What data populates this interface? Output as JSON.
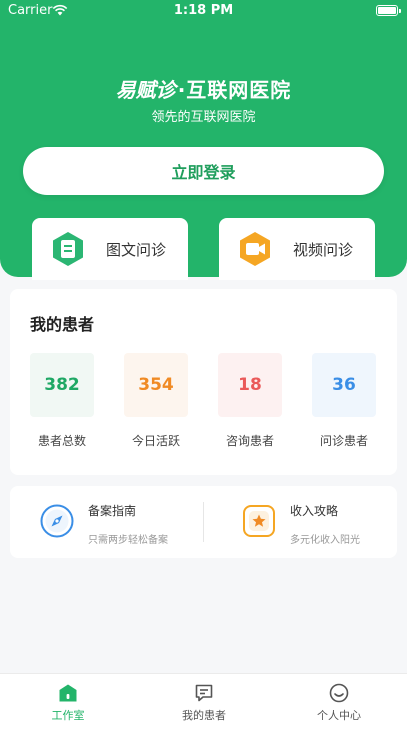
{
  "status_bar": {
    "carrier": "Carrier",
    "time": "1:18 PM"
  },
  "header": {
    "logo_mark": "易赋诊",
    "brand_suffix": "·互联网医院",
    "tagline": "领先的互联网医院",
    "login_label": "立即登录",
    "consult_options": [
      {
        "label": "图文问诊",
        "icon": "document-icon",
        "color": "#2bb673"
      },
      {
        "label": "视频问诊",
        "icon": "video-camera-icon",
        "color": "#f5a623"
      }
    ]
  },
  "my_patients": {
    "title": "我的患者",
    "stats": [
      {
        "value": "382",
        "label": "患者总数",
        "color": "#1fa865",
        "bg": "#f1f8f4"
      },
      {
        "value": "354",
        "label": "今日活跃",
        "color": "#f08a24",
        "bg": "#fdf5ee"
      },
      {
        "value": "18",
        "label": "咨询患者",
        "color": "#ea5a5a",
        "bg": "#fdf1f1"
      },
      {
        "value": "36",
        "label": "问诊患者",
        "color": "#3a8ee6",
        "bg": "#eff6fd"
      }
    ]
  },
  "guides": [
    {
      "title": "备案指南",
      "subtitle": "只需两步轻松备案",
      "icon": "compass-icon",
      "color": "#3a8ee6"
    },
    {
      "title": "收入攻略",
      "subtitle": "多元化收入阳光",
      "icon": "star-badge-icon",
      "color": "#f5a623"
    }
  ],
  "tab_bar": {
    "tabs": [
      {
        "label": "工作室",
        "icon": "home-icon",
        "active": true
      },
      {
        "label": "我的患者",
        "icon": "chat-icon",
        "active": false
      },
      {
        "label": "个人中心",
        "icon": "smile-icon",
        "active": false
      }
    ],
    "active_color": "#23b46a",
    "inactive_color": "#555555"
  },
  "colors": {
    "brand_green": "#23b46a",
    "page_background": "#f6f7f9"
  }
}
